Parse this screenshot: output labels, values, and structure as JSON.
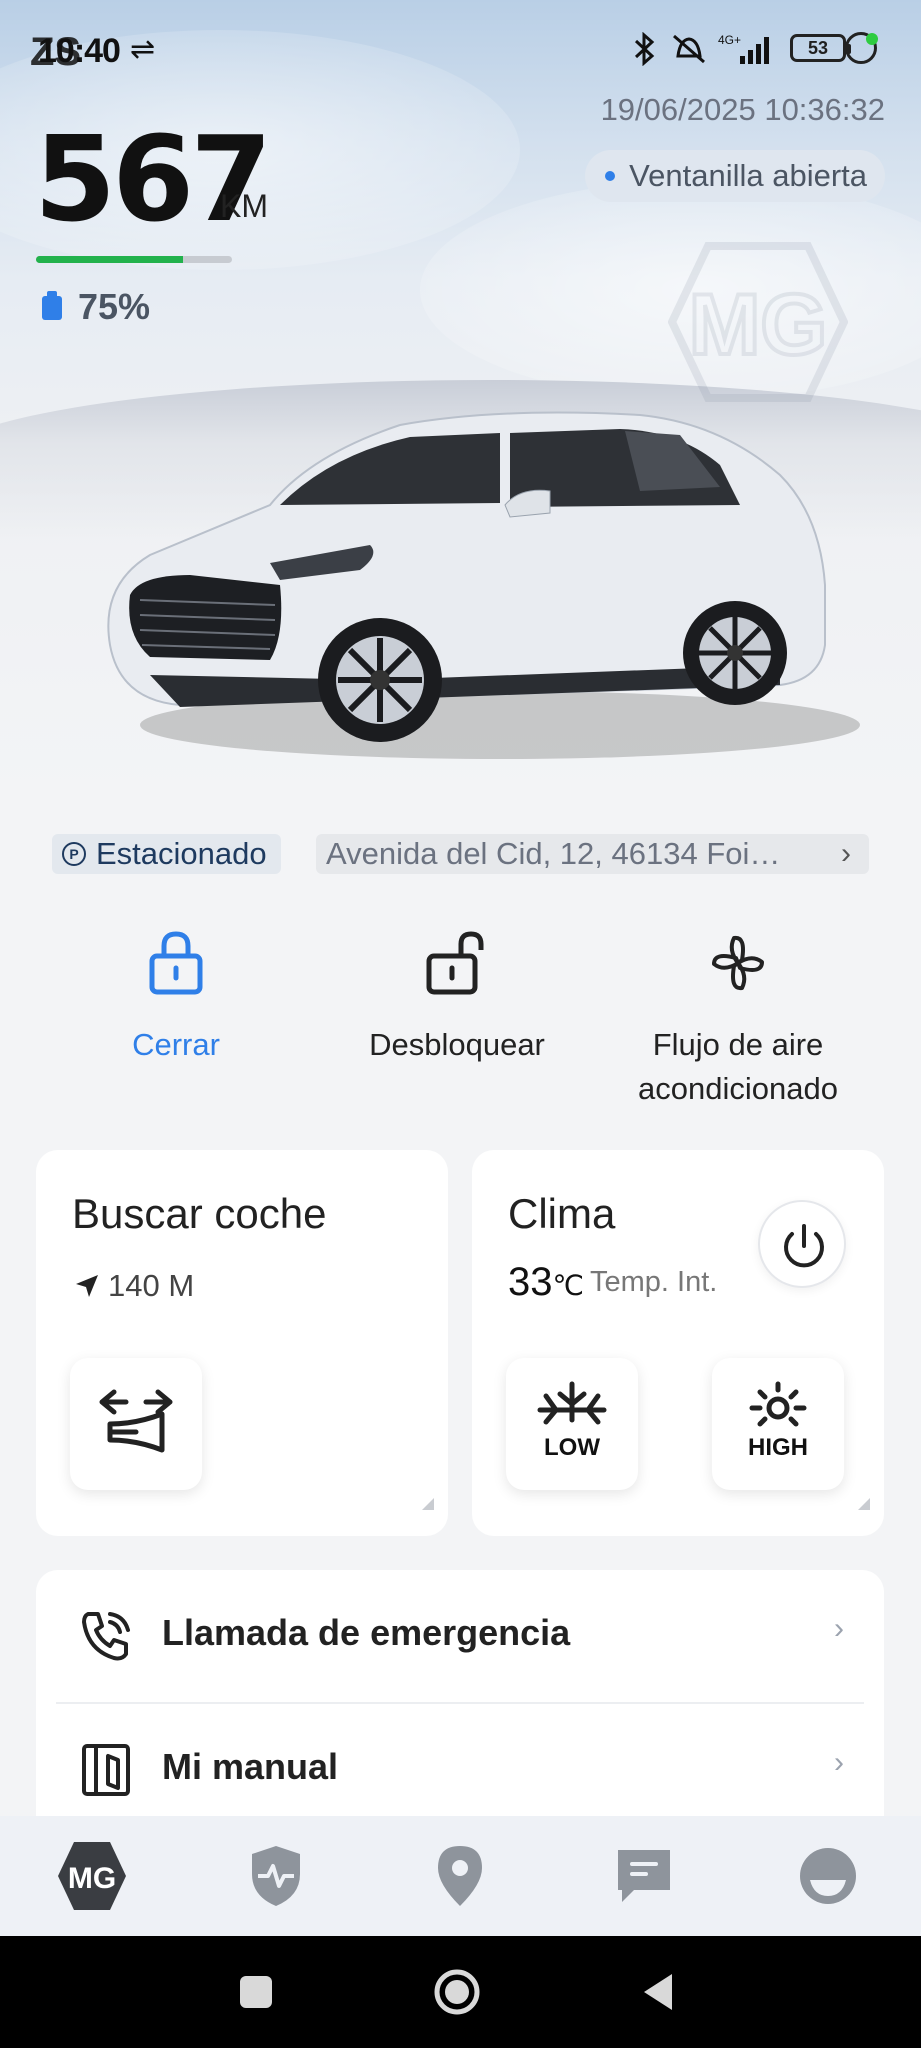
{
  "status_bar": {
    "time": "10:40",
    "overlay": "ZS",
    "battery": "53"
  },
  "vehicle": {
    "timestamp": "19/06/2025 10:36:32",
    "window_status": "Ventanilla abierta",
    "range_value": "567",
    "range_unit": "KM",
    "range_fraction": 0.75,
    "fuel_percent": "75%",
    "parking_status": "Estacionado",
    "address": "Avenida del Cid, 12, 46134 Foi…"
  },
  "quick_actions": [
    {
      "label": "Cerrar",
      "icon": "lock-icon",
      "active": true
    },
    {
      "label": "Desbloquear",
      "icon": "unlock-icon",
      "active": false
    },
    {
      "label": "Flujo de aire acondicionado",
      "icon": "fan-icon",
      "active": false
    }
  ],
  "find_car": {
    "title": "Buscar coche",
    "distance": "140 M",
    "tile_icon": "horn-lights-icon"
  },
  "climate": {
    "title": "Clima",
    "temperature": "33",
    "unit": "℃",
    "label": "Temp. Int.",
    "low_label": "LOW",
    "high_label": "HIGH"
  },
  "list": [
    {
      "label": "Llamada de emergencia",
      "icon": "phone-call-icon"
    },
    {
      "label": "Mi manual",
      "icon": "manual-book-icon"
    }
  ],
  "bottom_nav": [
    "mg-logo-icon",
    "shield-health-icon",
    "location-pin-icon",
    "message-icon",
    "profile-icon"
  ],
  "colors": {
    "accent": "#2f7fe8",
    "range_bar": "#22b24c"
  }
}
